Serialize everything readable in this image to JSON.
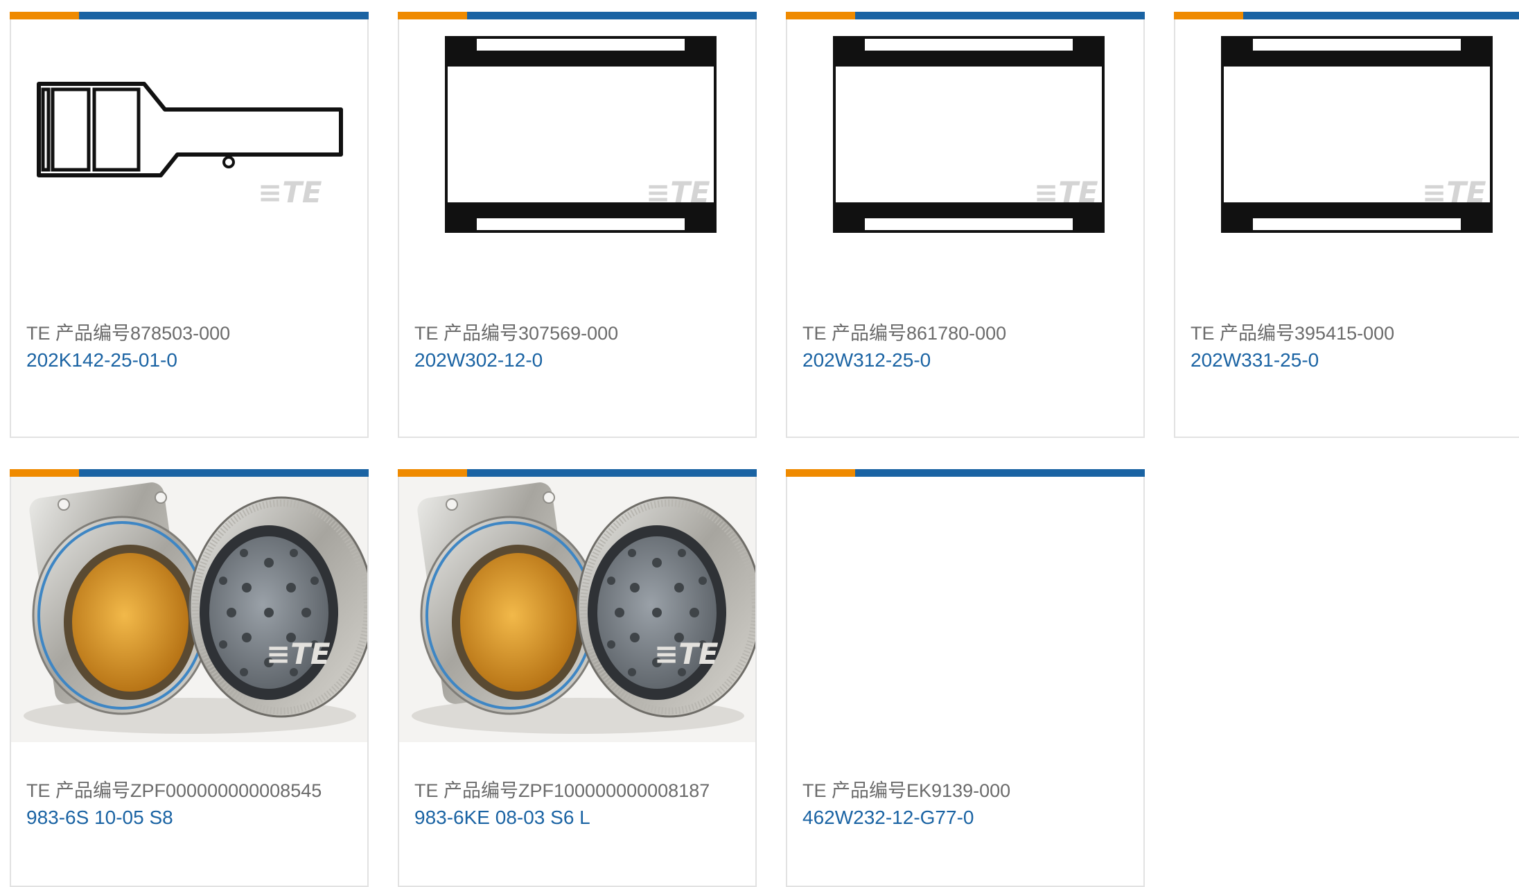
{
  "colors": {
    "accent_orange": "#ef8a00",
    "accent_blue": "#1a63a3",
    "border": "#e2e2e2",
    "label_gray": "#6b6b6b"
  },
  "watermark": "TE",
  "products": [
    {
      "label_prefix": "TE 产品编号",
      "part_number": "878503-000",
      "name": "202K142-25-01-0",
      "image": "heat-shrink-boot-drawing"
    },
    {
      "label_prefix": "TE 产品编号",
      "part_number": "307569-000",
      "name": "202W302-12-0",
      "image": "straight-sleeve-drawing"
    },
    {
      "label_prefix": "TE 产品编号",
      "part_number": "861780-000",
      "name": "202W312-25-0",
      "image": "straight-sleeve-drawing"
    },
    {
      "label_prefix": "TE 产品编号",
      "part_number": "395415-000",
      "name": "202W331-25-0",
      "image": "straight-sleeve-drawing"
    },
    {
      "label_prefix": "TE 产品编号",
      "part_number": "ZPF000000000008545",
      "name": "983-6S 10-05 S8",
      "image": "circular-connector-photo"
    },
    {
      "label_prefix": "TE 产品编号",
      "part_number": "ZPF100000000008187",
      "name": "983-6KE 08-03 S6 L",
      "image": "circular-connector-photo"
    },
    {
      "label_prefix": "TE 产品编号",
      "part_number": "EK9139-000",
      "name": "462W232-12-G77-0",
      "image": "none"
    }
  ]
}
